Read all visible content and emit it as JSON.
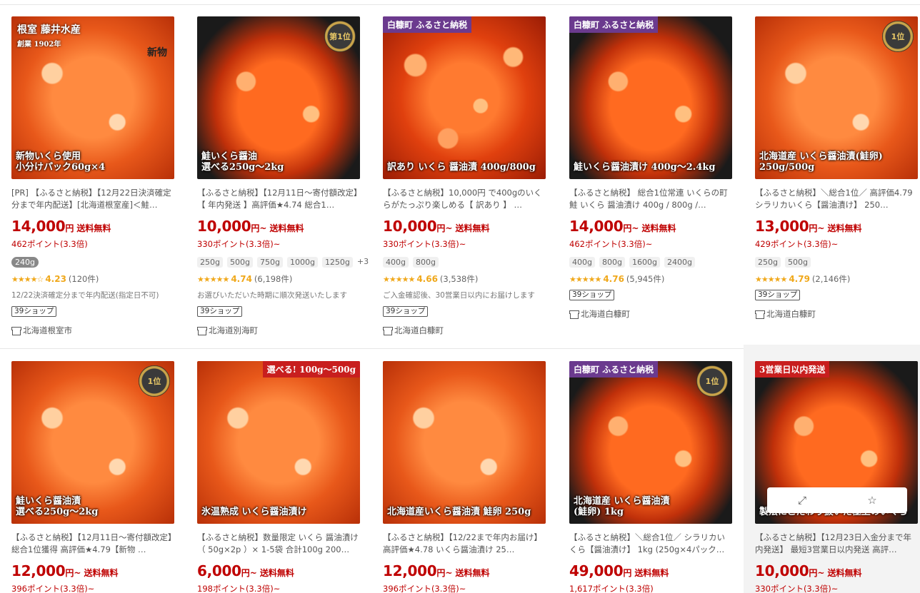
{
  "rows": [
    {
      "items": [
        {
          "title": "[PR] 【ふるさと納税】【12月22日決済確定分まで年内配送】[北海道根室産]＜鮭…",
          "price": "14,000",
          "price_suffix": "円",
          "shipping": "送料無料",
          "points": "462ポイント(3.3倍)",
          "variants": [
            "240g"
          ],
          "selected_variant": 0,
          "stars": "★★★★☆",
          "rating": "4.23",
          "reviews": "(120件)",
          "note": "12/22決済確定分まで年内配送(指定日不可)",
          "badge": "39ショップ",
          "shop": "北海道根室市",
          "thumb": {
            "style": "light",
            "sign": "根室 藤井水産",
            "sign2": "創業 1902年",
            "sign3": "新物",
            "caption": "新物いくら使用\n小分けパック60g×4"
          }
        },
        {
          "title": "【ふるさと納税】【12月11日～寄付額改定】【 年内発送 】高評価★4.74 総合1…",
          "price": "10,000",
          "price_suffix": "円~",
          "shipping": "送料無料",
          "points": "330ポイント(3.3倍)~",
          "variants": [
            "250g",
            "500g",
            "750g",
            "1000g",
            "1250g"
          ],
          "more": "+3",
          "stars": "★★★★★",
          "rating": "4.74",
          "reviews": "(6,198件)",
          "note": "お選びいただいた時期に順次発送いたします",
          "badge": "39ショップ",
          "shop": "北海道別海町",
          "thumb": {
            "style": "dark",
            "badge_text": "第1位",
            "caption": "鮭いくら醤油\n選べる250g～2kg"
          }
        },
        {
          "title": "【ふるさと納税】10,000円 で400gのいくらがたっぷり楽しめる【 訳あり 】 …",
          "price": "10,000",
          "price_suffix": "円~",
          "shipping": "送料無料",
          "points": "330ポイント(3.3倍)~",
          "variants": [
            "400g",
            "800g"
          ],
          "stars": "★★★★★",
          "rating": "4.66",
          "reviews": "(3,538件)",
          "note": "ご入金確認後、30営業日以内にお届けします",
          "badge": "39ショップ",
          "shop": "北海道白糠町",
          "thumb": {
            "style": "normal",
            "tag": "白糠町 ふるさと納税",
            "caption": "訳あり いくら 醤油漬 400g/800g"
          }
        },
        {
          "title": "【ふるさと納税】 総合1位常連 いくらの町 鮭 いくら 醤油漬け 400g / 800g /…",
          "price": "14,000",
          "price_suffix": "円~",
          "shipping": "送料無料",
          "points": "462ポイント(3.3倍)~",
          "variants": [
            "400g",
            "800g",
            "1600g",
            "2400g"
          ],
          "stars": "★★★★★",
          "rating": "4.76",
          "reviews": "(5,945件)",
          "badge": "39ショップ",
          "shop": "北海道白糠町",
          "thumb": {
            "style": "dark",
            "tag": "白糠町 ふるさと納税",
            "caption": "鮭いくら醤油漬け 400g～2.4kg"
          }
        },
        {
          "title": "【ふるさと納税】＼総合1位／ 高評価4.79 シラリカいくら【醤油漬け】 250…",
          "price": "13,000",
          "price_suffix": "円~",
          "shipping": "送料無料",
          "points": "429ポイント(3.3倍)~",
          "variants": [
            "250g",
            "500g"
          ],
          "stars": "★★★★★",
          "rating": "4.79",
          "reviews": "(2,146件)",
          "badge": "39ショップ",
          "shop": "北海道白糠町",
          "thumb": {
            "style": "light",
            "badge_text": "1位",
            "caption": "北海道産 いくら醤油漬(鮭卵)\n250g/500g"
          }
        }
      ]
    },
    {
      "items": [
        {
          "title": "【ふるさと納税】【12月11日～寄付額改定】総合1位獲得 高評価★4.79【新物 …",
          "price": "12,000",
          "price_suffix": "円~",
          "shipping": "送料無料",
          "points": "396ポイント(3.3倍)~",
          "thumb": {
            "style": "light",
            "badge_text": "1位",
            "caption": "鮭いくら醤油漬\n選べる250g～2kg"
          }
        },
        {
          "title": "【ふるさと納税】数量限定 いくら 醤油漬け（ 50g×2p ）× 1-5袋 合計100g 200…",
          "price": "6,000",
          "price_suffix": "円~",
          "shipping": "送料無料",
          "points": "198ポイント(3.3倍)~",
          "thumb": {
            "style": "light",
            "tag": "選べる! 100g～500g",
            "caption": "氷温熟成 いくら醤油漬け"
          }
        },
        {
          "title": "【ふるさと納税】【12/22まで年内お届け】 高評価★4.78 いくら醤油漬け 25…",
          "price": "12,000",
          "price_suffix": "円~",
          "shipping": "送料無料",
          "points": "396ポイント(3.3倍)~",
          "thumb": {
            "style": "light",
            "caption": "北海道産いくら醤油漬 鮭卵 250g"
          }
        },
        {
          "title": "【ふるさと納税】＼総合1位／ シラリカいくら【醤油漬け】 1kg (250g×4パック…",
          "price": "49,000",
          "price_suffix": "円",
          "shipping": "送料無料",
          "points": "1,617ポイント(3.3倍)",
          "thumb": {
            "style": "dark",
            "tag": "白糠町 ふるさと納税",
            "badge_text": "1位",
            "caption": "北海道産 いくら醤油漬\n(鮭卵) 1kg"
          }
        },
        {
          "title": "【ふるさと納税】【12月23日入金分まで年内発送】 最短3営業日以内発送 高評…",
          "price": "10,000",
          "price_suffix": "円~",
          "shipping": "送料無料",
          "points": "330ポイント(3.3倍)~",
          "thumb": {
            "style": "dark",
            "tag": "3営業日以内発送",
            "caption": "製法にこだわり抜いた極上のいくら"
          }
        }
      ]
    }
  ],
  "hover_actions": {
    "expand_icon": "expand-icon",
    "favorite_icon": "star-icon",
    "favorite_glyph": "☆",
    "expand_glyph": "⤢"
  },
  "colors": {
    "price": "#bf0000",
    "star": "#f0a81b"
  }
}
